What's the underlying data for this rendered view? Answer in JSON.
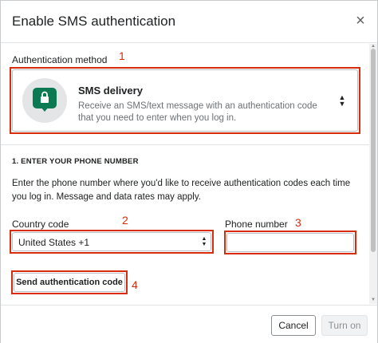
{
  "dialog": {
    "title": "Enable SMS authentication",
    "close_glyph": "×"
  },
  "method": {
    "label": "Authentication method",
    "option_title": "SMS delivery",
    "option_desc": "Receive an SMS/text message with an authentication code that you need to enter when you log in.",
    "icon": "sms-lock-icon",
    "icon_color": "#0b7a53",
    "chevrons": "▲\n▼"
  },
  "phone_section": {
    "title": "1. ENTER YOUR PHONE NUMBER",
    "text": "Enter the phone number where you'd like to receive authentication codes each time you log in. Message and data rates may apply.",
    "country_label": "Country code",
    "country_value": "United States +1",
    "country_chevrons": "▲\n▼",
    "phone_label": "Phone number",
    "phone_value": "",
    "send_label": "Send authentication code"
  },
  "footer": {
    "cancel_label": "Cancel",
    "turn_on_label": "Turn on"
  },
  "annotations": {
    "one": "1",
    "two": "2",
    "three": "3",
    "four": "4",
    "color": "#d82c0d"
  }
}
